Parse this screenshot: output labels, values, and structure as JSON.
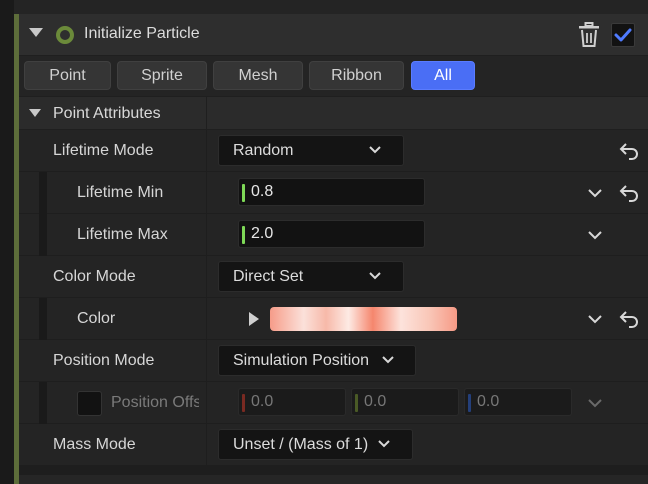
{
  "module": {
    "title": "Initialize Particle",
    "enabled": true,
    "accent_color": "#6b8a3a"
  },
  "tabs": [
    {
      "label": "Point",
      "active": false
    },
    {
      "label": "Sprite",
      "active": false
    },
    {
      "label": "Mesh",
      "active": false
    },
    {
      "label": "Ribbon",
      "active": false
    },
    {
      "label": "All",
      "active": true
    }
  ],
  "section": {
    "title": "Point Attributes"
  },
  "properties": {
    "lifetime_mode": {
      "label": "Lifetime Mode",
      "value": "Random"
    },
    "lifetime_min": {
      "label": "Lifetime Min",
      "value": "0.8"
    },
    "lifetime_max": {
      "label": "Lifetime Max",
      "value": "2.0"
    },
    "color_mode": {
      "label": "Color Mode",
      "value": "Direct Set"
    },
    "color": {
      "label": "Color"
    },
    "position_mode": {
      "label": "Position Mode",
      "value": "Simulation Position"
    },
    "position_offset": {
      "label": "Position Offs",
      "enabled": false,
      "x": "0.0",
      "y": "0.0",
      "z": "0.0"
    },
    "mass_mode": {
      "label": "Mass Mode",
      "value": "Unset / (Mass of 1)"
    }
  },
  "colors": {
    "active_tab": "#4a6ef5",
    "float_bar": "#7ed957",
    "axis_x": "#c0392b",
    "axis_y": "#6b8a3a",
    "axis_z": "#2f5fbf"
  }
}
